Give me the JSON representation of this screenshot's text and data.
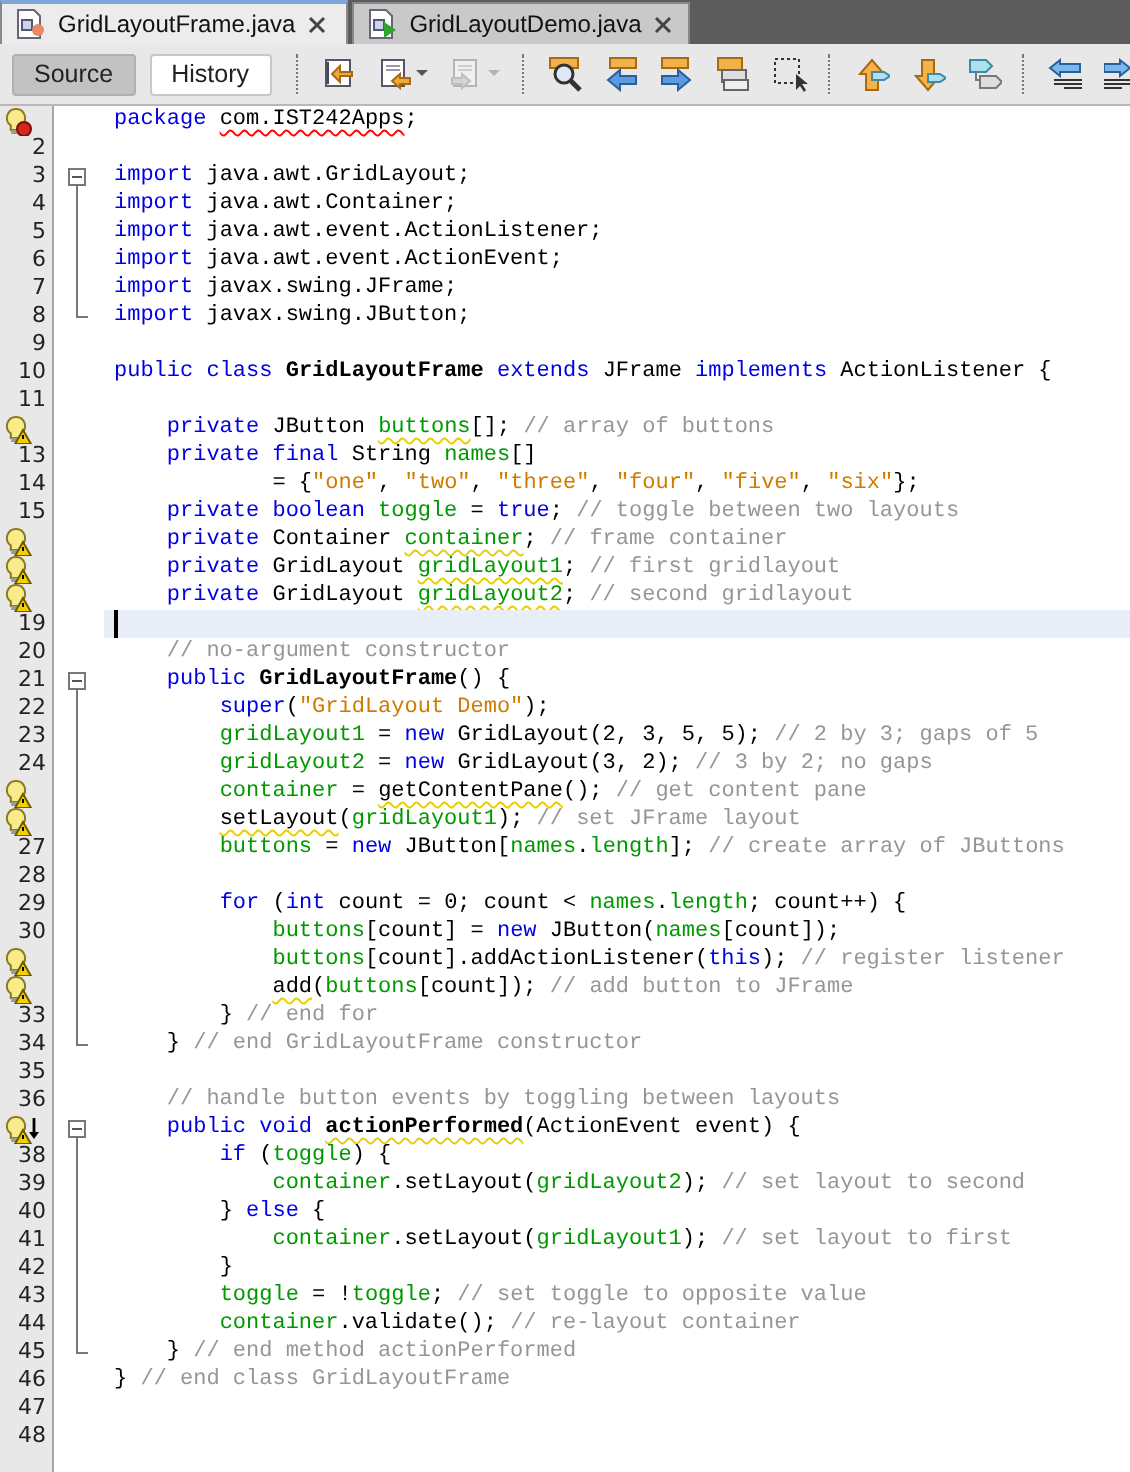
{
  "tabs": [
    {
      "label": "GridLayoutFrame.java",
      "selected": true,
      "kind": "class"
    },
    {
      "label": "GridLayoutDemo.java",
      "selected": false,
      "kind": "main"
    }
  ],
  "toolbar": {
    "views": [
      {
        "label": "Source",
        "selected": true
      },
      {
        "label": "History",
        "selected": false
      }
    ],
    "tool_groups": [
      [
        {
          "kind": "last-edit",
          "disabled": false
        },
        {
          "kind": "prev-change",
          "disabled": false
        },
        {
          "kind": "next-change",
          "disabled": true
        }
      ],
      [
        {
          "kind": "find",
          "disabled": false
        },
        {
          "kind": "find-prev",
          "disabled": false
        },
        {
          "kind": "find-next",
          "disabled": false
        },
        {
          "kind": "highlight",
          "disabled": false
        },
        {
          "kind": "select",
          "disabled": false
        }
      ],
      [
        {
          "kind": "bm-prev",
          "disabled": false
        },
        {
          "kind": "bm-next",
          "disabled": false
        },
        {
          "kind": "bm-toggle",
          "disabled": false
        }
      ],
      [
        {
          "kind": "shift-left",
          "disabled": false
        },
        {
          "kind": "shift-right",
          "disabled": false
        }
      ]
    ]
  },
  "editor": {
    "lines": [
      {
        "error": true,
        "tokens": [
          {
            "kind": "kw",
            "text": "package"
          },
          {
            "kind": "plain",
            "text": " com.IST242Apps",
            "error": true
          },
          {
            "kind": "plain",
            "text": ";"
          }
        ]
      },
      {
        "number": "2"
      },
      {
        "number": "3",
        "fold_start": true,
        "tokens": [
          {
            "kind": "kw",
            "text": "import"
          },
          {
            "kind": "plain",
            "text": " java.awt.GridLayout;"
          }
        ]
      },
      {
        "number": "4",
        "tokens": [
          {
            "kind": "kw",
            "text": "import"
          },
          {
            "kind": "plain",
            "text": " java.awt.Container;"
          }
        ]
      },
      {
        "number": "5",
        "tokens": [
          {
            "kind": "kw",
            "text": "import"
          },
          {
            "kind": "plain",
            "text": " java.awt.event.ActionListener;"
          }
        ]
      },
      {
        "number": "6",
        "tokens": [
          {
            "kind": "kw",
            "text": "import"
          },
          {
            "kind": "plain",
            "text": " java.awt.event.ActionEvent;"
          }
        ]
      },
      {
        "number": "7",
        "tokens": [
          {
            "kind": "kw",
            "text": "import"
          },
          {
            "kind": "plain",
            "text": " javax.swing.JFrame;"
          }
        ]
      },
      {
        "number": "8",
        "fold_end": true,
        "tokens": [
          {
            "kind": "kw",
            "text": "import"
          },
          {
            "kind": "plain",
            "text": " javax.swing.JButton;"
          }
        ]
      },
      {
        "number": "9"
      },
      {
        "number": "10",
        "tokens": [
          {
            "kind": "kw",
            "text": "public"
          },
          {
            "kind": "kw",
            "text": " class"
          },
          {
            "kind": "decl",
            "text": " GridLayoutFrame"
          },
          {
            "kind": "kw",
            "text": " extends"
          },
          {
            "kind": "plain",
            "text": " JFrame"
          },
          {
            "kind": "kw",
            "text": " implements"
          },
          {
            "kind": "plain",
            "text": " ActionListener {"
          }
        ]
      },
      {
        "number": "11"
      },
      {
        "warning": true,
        "tokens": [
          {
            "kind": "kw",
            "text": "    private"
          },
          {
            "kind": "plain",
            "text": " JButton"
          },
          {
            "kind": "field",
            "text": " buttons",
            "warning": true
          },
          {
            "kind": "plain",
            "text": "[];"
          },
          {
            "kind": "comment",
            "text": " // array of buttons"
          }
        ]
      },
      {
        "number": "13",
        "tokens": [
          {
            "kind": "kw",
            "text": "    private final"
          },
          {
            "kind": "plain",
            "text": " String"
          },
          {
            "kind": "field",
            "text": " names"
          },
          {
            "kind": "plain",
            "text": "[]"
          }
        ]
      },
      {
        "number": "14",
        "tokens": [
          {
            "kind": "plain",
            "text": "            = {"
          },
          {
            "kind": "str",
            "text": "\"one\""
          },
          {
            "kind": "plain",
            "text": ","
          },
          {
            "kind": "str",
            "text": " \"two\""
          },
          {
            "kind": "plain",
            "text": ","
          },
          {
            "kind": "str",
            "text": " \"three\""
          },
          {
            "kind": "plain",
            "text": ","
          },
          {
            "kind": "str",
            "text": " \"four\""
          },
          {
            "kind": "plain",
            "text": ","
          },
          {
            "kind": "str",
            "text": " \"five\""
          },
          {
            "kind": "plain",
            "text": ","
          },
          {
            "kind": "str",
            "text": " \"six\""
          },
          {
            "kind": "plain",
            "text": "};"
          }
        ]
      },
      {
        "number": "15",
        "tokens": [
          {
            "kind": "kw",
            "text": "    private boolean"
          },
          {
            "kind": "field",
            "text": " toggle"
          },
          {
            "kind": "plain",
            "text": " ="
          },
          {
            "kind": "kw",
            "text": " true"
          },
          {
            "kind": "plain",
            "text": ";"
          },
          {
            "kind": "comment",
            "text": " // toggle between two layouts"
          }
        ]
      },
      {
        "warning": true,
        "tokens": [
          {
            "kind": "kw",
            "text": "    private"
          },
          {
            "kind": "plain",
            "text": " Container"
          },
          {
            "kind": "field",
            "text": " container",
            "warning": true
          },
          {
            "kind": "plain",
            "text": ";"
          },
          {
            "kind": "comment",
            "text": " // frame container"
          }
        ]
      },
      {
        "warning": true,
        "tokens": [
          {
            "kind": "kw",
            "text": "    private"
          },
          {
            "kind": "plain",
            "text": " GridLayout"
          },
          {
            "kind": "field",
            "text": " gridLayout1",
            "warning": true
          },
          {
            "kind": "plain",
            "text": ";"
          },
          {
            "kind": "comment",
            "text": " // first gridlayout"
          }
        ]
      },
      {
        "warning": true,
        "tokens": [
          {
            "kind": "kw",
            "text": "    private"
          },
          {
            "kind": "plain",
            "text": " GridLayout"
          },
          {
            "kind": "field",
            "text": " gridLayout2",
            "warning": true
          },
          {
            "kind": "plain",
            "text": ";"
          },
          {
            "kind": "comment",
            "text": " // second gridlayout"
          }
        ]
      },
      {
        "number": "19",
        "current": true
      },
      {
        "number": "20",
        "tokens": [
          {
            "kind": "comment",
            "text": "    // no-argument constructor"
          }
        ]
      },
      {
        "number": "21",
        "fold_start": true,
        "tokens": [
          {
            "kind": "kw",
            "text": "    public"
          },
          {
            "kind": "decl",
            "text": " GridLayoutFrame"
          },
          {
            "kind": "plain",
            "text": "() {"
          }
        ]
      },
      {
        "number": "22",
        "tokens": [
          {
            "kind": "kw",
            "text": "        super"
          },
          {
            "kind": "plain",
            "text": "("
          },
          {
            "kind": "str",
            "text": "\"GridLayout Demo\""
          },
          {
            "kind": "plain",
            "text": ");"
          }
        ]
      },
      {
        "number": "23",
        "tokens": [
          {
            "kind": "field",
            "text": "        gridLayout1"
          },
          {
            "kind": "plain",
            "text": " ="
          },
          {
            "kind": "kw",
            "text": " new"
          },
          {
            "kind": "plain",
            "text": " GridLayout(2, 3, 5, 5);"
          },
          {
            "kind": "comment",
            "text": " // 2 by 3; gaps of 5"
          }
        ]
      },
      {
        "number": "24",
        "tokens": [
          {
            "kind": "field",
            "text": "        gridLayout2"
          },
          {
            "kind": "plain",
            "text": " ="
          },
          {
            "kind": "kw",
            "text": " new"
          },
          {
            "kind": "plain",
            "text": " GridLayout(3, 2);"
          },
          {
            "kind": "comment",
            "text": " // 3 by 2; no gaps"
          }
        ]
      },
      {
        "warning": true,
        "tokens": [
          {
            "kind": "field",
            "text": "        container"
          },
          {
            "kind": "plain",
            "text": " ="
          },
          {
            "kind": "plain",
            "text": " getContentPane",
            "warning": true
          },
          {
            "kind": "plain",
            "text": "();"
          },
          {
            "kind": "comment",
            "text": " // get content pane"
          }
        ]
      },
      {
        "warning": true,
        "tokens": [
          {
            "kind": "plain",
            "text": "        setLayout",
            "warning": true
          },
          {
            "kind": "plain",
            "text": "("
          },
          {
            "kind": "field",
            "text": "gridLayout1"
          },
          {
            "kind": "plain",
            "text": ");"
          },
          {
            "kind": "comment",
            "text": " // set JFrame layout"
          }
        ]
      },
      {
        "number": "27",
        "tokens": [
          {
            "kind": "field",
            "text": "        buttons"
          },
          {
            "kind": "plain",
            "text": " ="
          },
          {
            "kind": "kw",
            "text": " new"
          },
          {
            "kind": "plain",
            "text": " JButton["
          },
          {
            "kind": "field",
            "text": "names"
          },
          {
            "kind": "plain",
            "text": "."
          },
          {
            "kind": "field",
            "text": "length"
          },
          {
            "kind": "plain",
            "text": "];"
          },
          {
            "kind": "comment",
            "text": " // create array of JButtons"
          }
        ]
      },
      {
        "number": "28"
      },
      {
        "number": "29",
        "tokens": [
          {
            "kind": "kw",
            "text": "        for"
          },
          {
            "kind": "plain",
            "text": " ("
          },
          {
            "kind": "kw",
            "text": "int"
          },
          {
            "kind": "plain",
            "text": " count = 0; count <"
          },
          {
            "kind": "field",
            "text": " names"
          },
          {
            "kind": "plain",
            "text": "."
          },
          {
            "kind": "field",
            "text": "length"
          },
          {
            "kind": "plain",
            "text": "; count++) {"
          }
        ]
      },
      {
        "number": "30",
        "tokens": [
          {
            "kind": "field",
            "text": "            buttons"
          },
          {
            "kind": "plain",
            "text": "[count] ="
          },
          {
            "kind": "kw",
            "text": " new"
          },
          {
            "kind": "plain",
            "text": " JButton("
          },
          {
            "kind": "field",
            "text": "names"
          },
          {
            "kind": "plain",
            "text": "[count]);"
          }
        ]
      },
      {
        "warning": true,
        "tokens": [
          {
            "kind": "field",
            "text": "            buttons"
          },
          {
            "kind": "plain",
            "text": "[count].addActionListener("
          },
          {
            "kind": "kw",
            "text": "this"
          },
          {
            "kind": "plain",
            "text": ");"
          },
          {
            "kind": "comment",
            "text": " // register listener"
          }
        ]
      },
      {
        "warning": true,
        "tokens": [
          {
            "kind": "plain",
            "text": "            add",
            "warning": true
          },
          {
            "kind": "plain",
            "text": "("
          },
          {
            "kind": "field",
            "text": "buttons"
          },
          {
            "kind": "plain",
            "text": "[count]);"
          },
          {
            "kind": "comment",
            "text": " // add button to JFrame"
          }
        ]
      },
      {
        "number": "33",
        "tokens": [
          {
            "kind": "plain",
            "text": "        }"
          },
          {
            "kind": "comment",
            "text": " // end for"
          }
        ]
      },
      {
        "number": "34",
        "fold_end": true,
        "tokens": [
          {
            "kind": "plain",
            "text": "    }"
          },
          {
            "kind": "comment",
            "text": " // end GridLayoutFrame constructor"
          }
        ]
      },
      {
        "number": "35"
      },
      {
        "number": "36",
        "tokens": [
          {
            "kind": "comment",
            "text": "    // handle button events by toggling between layouts"
          }
        ]
      },
      {
        "warning": true,
        "overrides": true,
        "fold_start": true,
        "tokens": [
          {
            "kind": "kw",
            "text": "    public void"
          },
          {
            "kind": "decl",
            "text": " actionPerformed",
            "warning": true
          },
          {
            "kind": "plain",
            "text": "(ActionEvent event) {"
          }
        ]
      },
      {
        "number": "38",
        "tokens": [
          {
            "kind": "kw",
            "text": "        if"
          },
          {
            "kind": "plain",
            "text": " ("
          },
          {
            "kind": "field",
            "text": "toggle"
          },
          {
            "kind": "plain",
            "text": ") {"
          }
        ]
      },
      {
        "number": "39",
        "tokens": [
          {
            "kind": "field",
            "text": "            container"
          },
          {
            "kind": "plain",
            "text": ".setLayout("
          },
          {
            "kind": "field",
            "text": "gridLayout2"
          },
          {
            "kind": "plain",
            "text": ");"
          },
          {
            "kind": "comment",
            "text": " // set layout to second"
          }
        ]
      },
      {
        "number": "40",
        "tokens": [
          {
            "kind": "plain",
            "text": "        }"
          },
          {
            "kind": "kw",
            "text": " else"
          },
          {
            "kind": "plain",
            "text": " {"
          }
        ]
      },
      {
        "number": "41",
        "tokens": [
          {
            "kind": "field",
            "text": "            container"
          },
          {
            "kind": "plain",
            "text": ".setLayout("
          },
          {
            "kind": "field",
            "text": "gridLayout1"
          },
          {
            "kind": "plain",
            "text": ");"
          },
          {
            "kind": "comment",
            "text": " // set layout to first"
          }
        ]
      },
      {
        "number": "42",
        "tokens": [
          {
            "kind": "plain",
            "text": "        }"
          }
        ]
      },
      {
        "number": "43",
        "tokens": [
          {
            "kind": "field",
            "text": "        toggle"
          },
          {
            "kind": "plain",
            "text": " = !"
          },
          {
            "kind": "field",
            "text": "toggle"
          },
          {
            "kind": "plain",
            "text": ";"
          },
          {
            "kind": "comment",
            "text": " // set toggle to opposite value"
          }
        ]
      },
      {
        "number": "44",
        "tokens": [
          {
            "kind": "field",
            "text": "        container"
          },
          {
            "kind": "plain",
            "text": ".validate();"
          },
          {
            "kind": "comment",
            "text": " // re-layout container"
          }
        ]
      },
      {
        "number": "45",
        "fold_end": true,
        "tokens": [
          {
            "kind": "plain",
            "text": "    }"
          },
          {
            "kind": "comment",
            "text": " // end method actionPerformed"
          }
        ]
      },
      {
        "number": "46",
        "tokens": [
          {
            "kind": "plain",
            "text": "}"
          },
          {
            "kind": "comment",
            "text": " // end class GridLayoutFrame"
          }
        ]
      },
      {
        "number": "47"
      },
      {
        "number": "48"
      }
    ]
  }
}
